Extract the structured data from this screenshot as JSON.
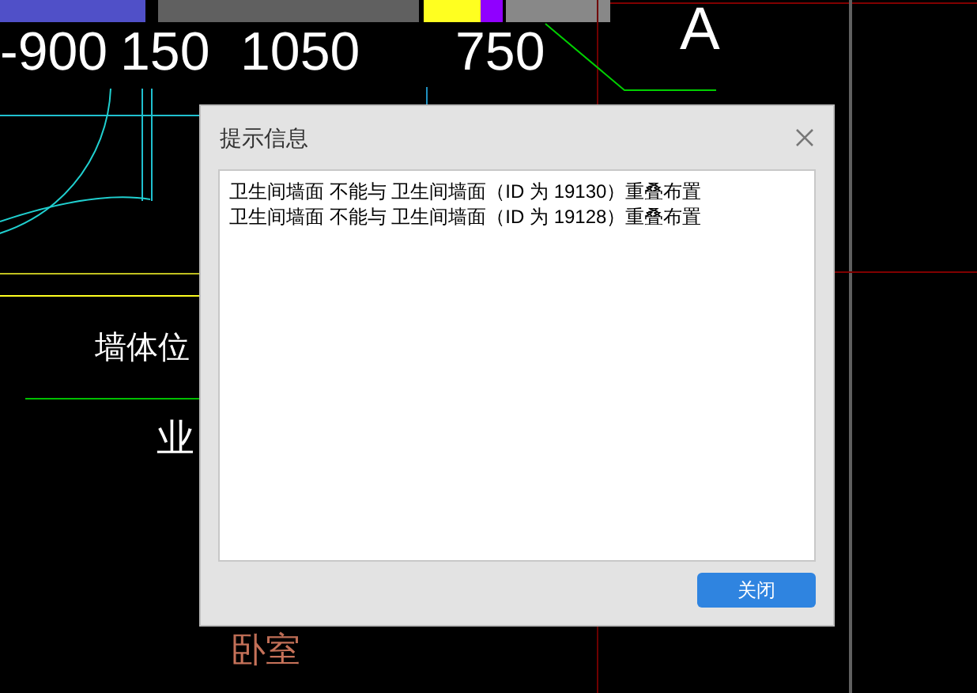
{
  "drawing_labels": [
    {
      "text": "-900",
      "color": "#ffffff"
    },
    {
      "text": "150",
      "color": "#ffffff"
    },
    {
      "text": "1050",
      "color": "#ffffff"
    },
    {
      "text": "750",
      "color": "#ffffff"
    },
    {
      "text": "A",
      "color": "#ffffff"
    },
    {
      "text": "墙体位",
      "color": "#ffffff"
    },
    {
      "text": "业",
      "color": "#ffffff"
    },
    {
      "text": "卧室",
      "color": "#c8735a"
    }
  ],
  "dialog": {
    "title": "提示信息",
    "messages": [
      "卫生间墙面 不能与 卫生间墙面（ID 为 19130）重叠布置",
      "卫生间墙面 不能与 卫生间墙面（ID 为 19128）重叠布置"
    ],
    "button": "关闭"
  }
}
